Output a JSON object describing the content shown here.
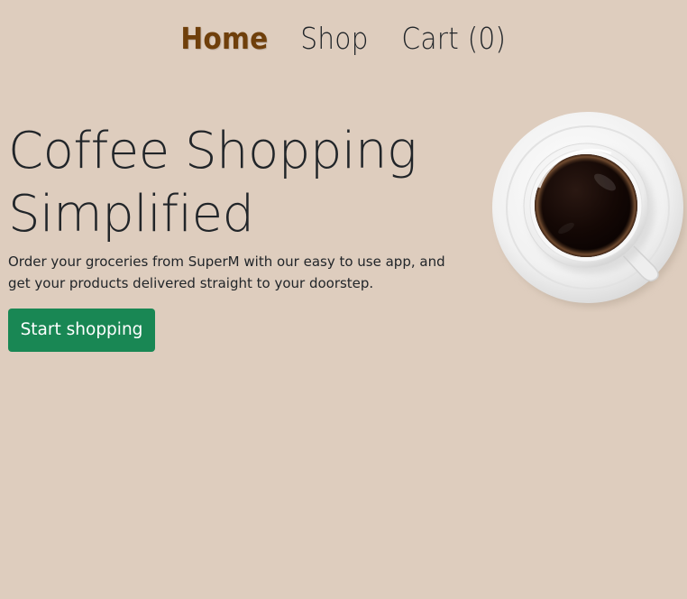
{
  "nav": {
    "items": [
      {
        "label": "Home",
        "active": true
      },
      {
        "label": "Shop",
        "active": false
      },
      {
        "label": "Cart (0)",
        "active": false
      }
    ]
  },
  "hero": {
    "title_line1": "Coffee Shopping",
    "title_line2": "Simplified",
    "description": "Order your groceries from SuperM with our easy to use app, and get your products delivered straight to your doorstep.",
    "cta_label": "Start shopping",
    "image_icon": "coffee-cup-image"
  },
  "colors": {
    "background": "#decdbe",
    "nav_active": "#6f3f0b",
    "cta": "#198754",
    "text": "#212529"
  }
}
